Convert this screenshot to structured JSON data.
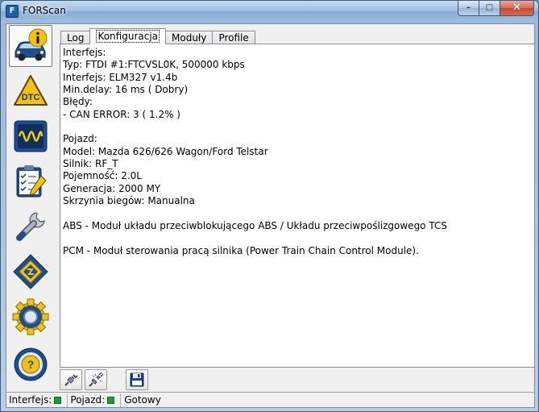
{
  "window": {
    "title": "FORScan",
    "app_icon_glyph": "F",
    "minimize_glyph": "–",
    "maximize_glyph": "□",
    "close_glyph": "✕"
  },
  "sidebar": {
    "items": [
      {
        "name": "info",
        "icon": "car-info-icon",
        "active": true
      },
      {
        "name": "dtc",
        "icon": "dtc-warning-icon",
        "label": "DTC"
      },
      {
        "name": "oscilloscope",
        "icon": "oscilloscope-icon"
      },
      {
        "name": "tests",
        "icon": "checklist-icon"
      },
      {
        "name": "service",
        "icon": "wrench-icon"
      },
      {
        "name": "configuration",
        "icon": "chip-icon"
      },
      {
        "name": "settings",
        "icon": "gear-icon"
      },
      {
        "name": "help",
        "icon": "help-wheel-icon",
        "label": "?"
      }
    ]
  },
  "tabs": [
    {
      "label": "Log",
      "active": false
    },
    {
      "label": "Konfiguracja",
      "active": true
    },
    {
      "label": "Moduły",
      "active": false
    },
    {
      "label": "Profile",
      "active": false
    }
  ],
  "content": {
    "lines": [
      "Interfejs:",
      "Typ: FTDI #1:FTCVSL0K, 500000 kbps",
      "Interfejs: ELM327 v1.4b",
      "Min.delay: 16 ms ( Dobry)",
      "Błędy:",
      "- CAN ERROR: 3 ( 1.2% )",
      "",
      "Pojazd:",
      "Model: Mazda 626/626 Wagon/Ford Telstar",
      "Silnik: RF_T",
      "Pojemność: 2.0L",
      "Generacja: 2000 MY",
      "Skrzynia biegów: Manualna",
      "",
      "ABS - Moduł układu przeciwblokującego ABS / Układu przeciwpoślizgowego TCS",
      "",
      "PCM - Moduł sterowania pracą silnika (Power Train Chain Control Module)."
    ]
  },
  "bottom_toolbar": {
    "buttons": [
      {
        "name": "connect",
        "icon": "plug-connect-icon"
      },
      {
        "name": "disconnect",
        "icon": "plug-disconnect-icon"
      },
      {
        "name": "save",
        "icon": "floppy-disk-icon"
      }
    ]
  },
  "statusbar": {
    "interface_label": "Interfejs:",
    "vehicle_label": "Pojazd:",
    "status_text": "Gotowy",
    "indicator_color": "#1c9a3a"
  }
}
